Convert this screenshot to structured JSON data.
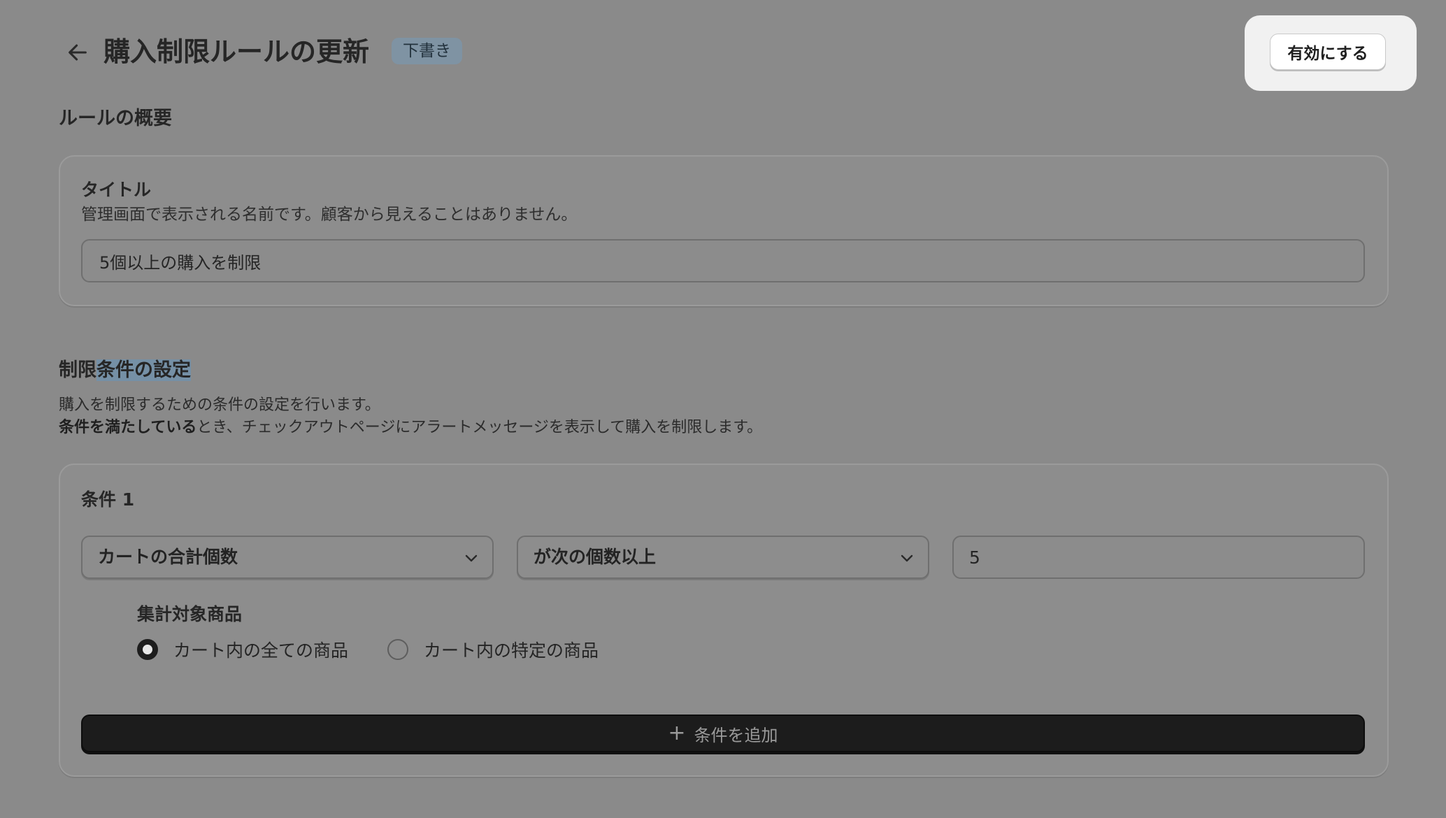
{
  "header": {
    "title": "購入制限ルールの更新",
    "status_badge": "下書き",
    "activate_button": "有効にする"
  },
  "overview": {
    "heading": "ルールの概要",
    "title_field": {
      "label": "タイトル",
      "help": "管理画面で表示される名前です。顧客から見えることはありません。",
      "value": "5個以上の購入を制限"
    }
  },
  "conditions_section": {
    "heading_part1": "制限",
    "heading_part2_highlighted": "条件の設定",
    "desc_line1": "購入を制限するための条件の設定を行います。",
    "desc_line2_bold": "条件を満たしている",
    "desc_line2_rest": "とき、チェックアウトページにアラートメッセージを表示して購入を制限します。",
    "condition": {
      "title": "条件 1",
      "metric_select": "カートの合計個数",
      "operator_select": "が次の個数以上",
      "value": "5",
      "target_group_label": "集計対象商品",
      "target_options": [
        {
          "label": "カート内の全ての商品",
          "selected": true
        },
        {
          "label": "カート内の特定の商品",
          "selected": false
        }
      ]
    },
    "add_condition_button": "条件を追加"
  },
  "icons": {
    "back": "arrow-left-icon",
    "chevron": "chevron-down-icon",
    "plus": "plus-icon"
  }
}
